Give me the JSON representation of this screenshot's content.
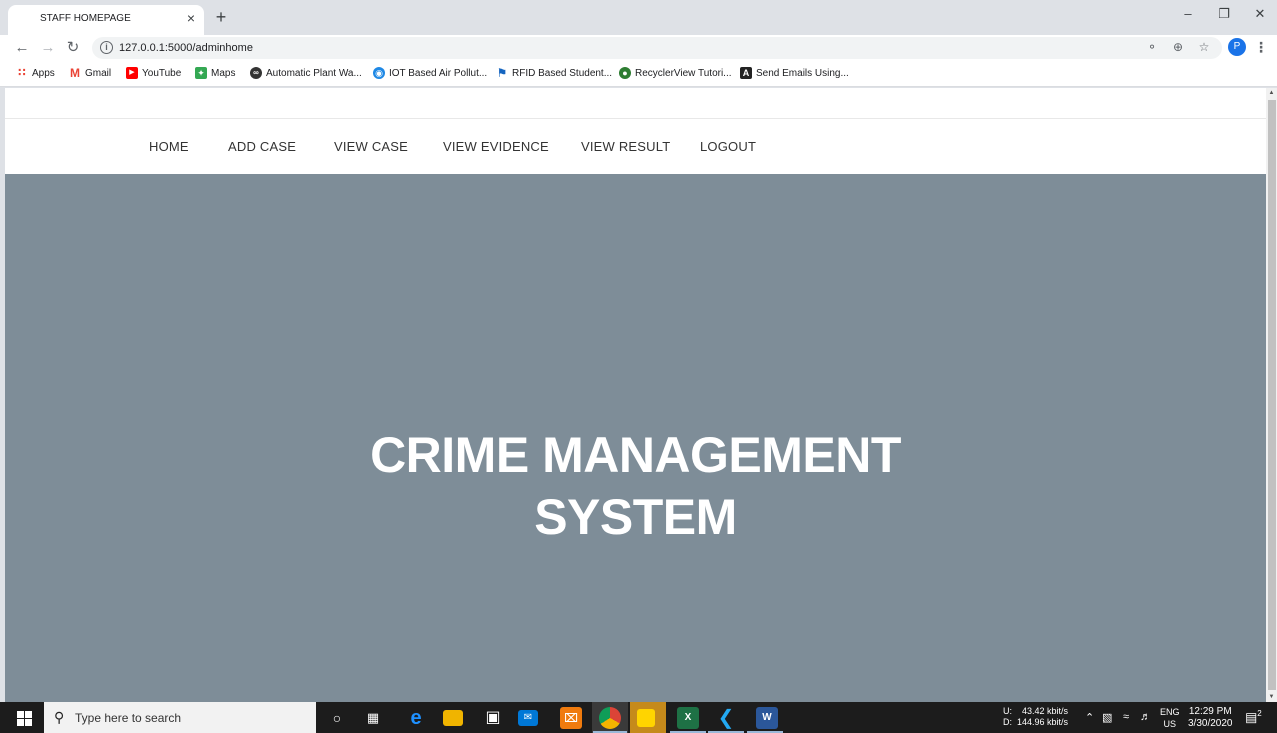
{
  "browser": {
    "tab_title": "STAFF HOMEPAGE",
    "tab_close": "×",
    "new_tab": "+",
    "url": "127.0.0.1:5000/adminhome",
    "profile_initial": "P",
    "bookmarks": [
      {
        "label": "Apps",
        "icon": "apps-grid-icon",
        "color": "#ea4335"
      },
      {
        "label": "Gmail",
        "icon": "gmail-icon",
        "color": "#ea4335"
      },
      {
        "label": "YouTube",
        "icon": "youtube-icon",
        "color": "#ff0000"
      },
      {
        "label": "Maps",
        "icon": "maps-icon",
        "color": "#34a853"
      },
      {
        "label": "Automatic Plant Wa...",
        "icon": "infinity-icon",
        "color": "#333333"
      },
      {
        "label": "IOT Based Air Pollut...",
        "icon": "globe-icon",
        "color": "#1e88e5"
      },
      {
        "label": "RFID Based Student...",
        "icon": "flag-icon",
        "color": "#1565c0"
      },
      {
        "label": "RecyclerView Tutori...",
        "icon": "android-icon",
        "color": "#2e7d32"
      },
      {
        "label": "Send Emails Using...",
        "icon": "mail-app-icon",
        "color": "#222222"
      }
    ]
  },
  "site": {
    "nav": [
      "HOME",
      "ADD CASE",
      "VIEW CASE",
      "VIEW EVIDENCE",
      "VIEW RESULT",
      "LOGOUT"
    ],
    "hero_line1": "CRIME MANAGEMENT",
    "hero_line2": "SYSTEM",
    "hero_bg": "#7e8d98"
  },
  "taskbar": {
    "search_placeholder": "Type here to search",
    "net_up_label": "U:",
    "net_up": "43.42 kbit/s",
    "net_down_label": "D:",
    "net_down": "144.96 kbit/s",
    "lang": "ENG",
    "region": "US",
    "time": "12:29 PM",
    "date": "3/30/2020",
    "notification_count": "2"
  }
}
